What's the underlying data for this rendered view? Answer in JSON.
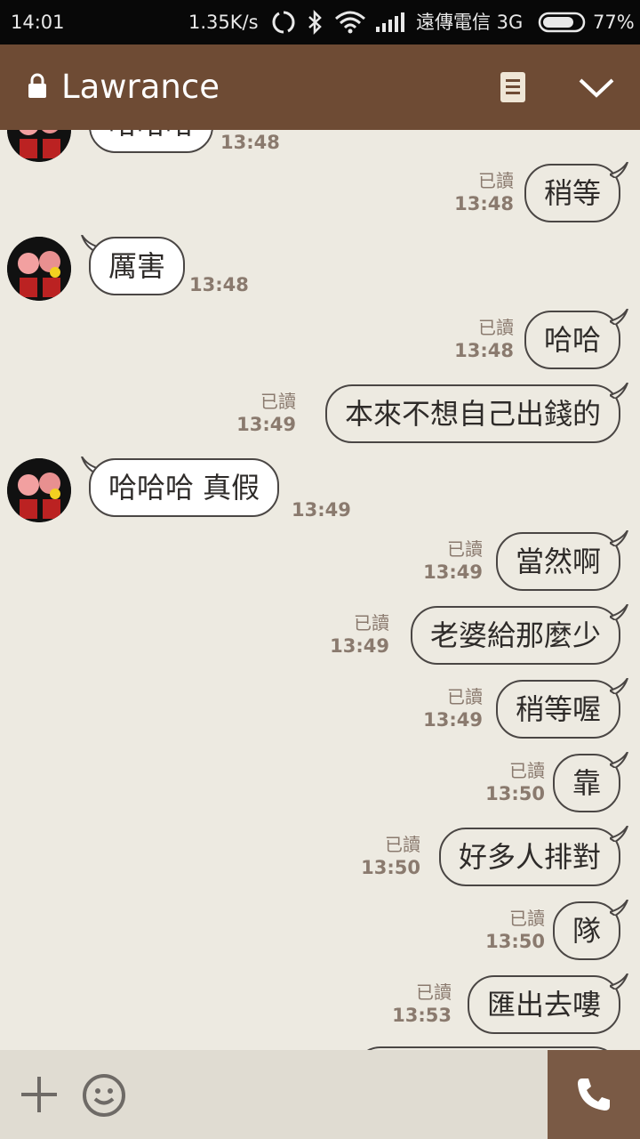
{
  "status_bar": {
    "time": "14:01",
    "speed": "1.35K/s",
    "carrier": "遠傳電信 3G",
    "battery": "77%"
  },
  "header": {
    "title": "Lawrance",
    "icons": [
      "lock-icon",
      "notes-icon",
      "chevron-down-icon"
    ]
  },
  "messages": [
    {
      "dir": "in",
      "text": "哈哈哈",
      "time": "13:48"
    },
    {
      "dir": "out",
      "text": "稍等",
      "read": "已讀",
      "time": "13:48"
    },
    {
      "dir": "in",
      "text": "厲害",
      "time": "13:48"
    },
    {
      "dir": "out",
      "text": "哈哈",
      "read": "已讀",
      "time": "13:48"
    },
    {
      "dir": "out",
      "text": "本來不想自己出錢的",
      "read": "已讀",
      "time": "13:49"
    },
    {
      "dir": "in",
      "text": "哈哈哈 真假",
      "time": "13:49"
    },
    {
      "dir": "out",
      "text": "當然啊",
      "read": "已讀",
      "time": "13:49"
    },
    {
      "dir": "out",
      "text": "老婆給那麼少",
      "read": "已讀",
      "time": "13:49"
    },
    {
      "dir": "out",
      "text": "稍等喔",
      "read": "已讀",
      "time": "13:49"
    },
    {
      "dir": "out",
      "text": "靠",
      "read": "已讀",
      "time": "13:50"
    },
    {
      "dir": "out",
      "text": "好多人排對",
      "read": "已讀",
      "time": "13:50"
    },
    {
      "dir": "out",
      "text": "隊",
      "read": "已讀",
      "time": "13:50"
    },
    {
      "dir": "out",
      "text": "匯出去嘍",
      "read": "已讀",
      "time": "13:53"
    }
  ],
  "input_bar": {
    "icons": [
      "plus-icon",
      "emoji-icon",
      "phone-icon"
    ]
  },
  "colors": {
    "header_bg": "#6e4b34",
    "chat_bg": "#edeae1",
    "call_button_bg": "#7a5a45",
    "meta_text": "#8a7a6e"
  }
}
